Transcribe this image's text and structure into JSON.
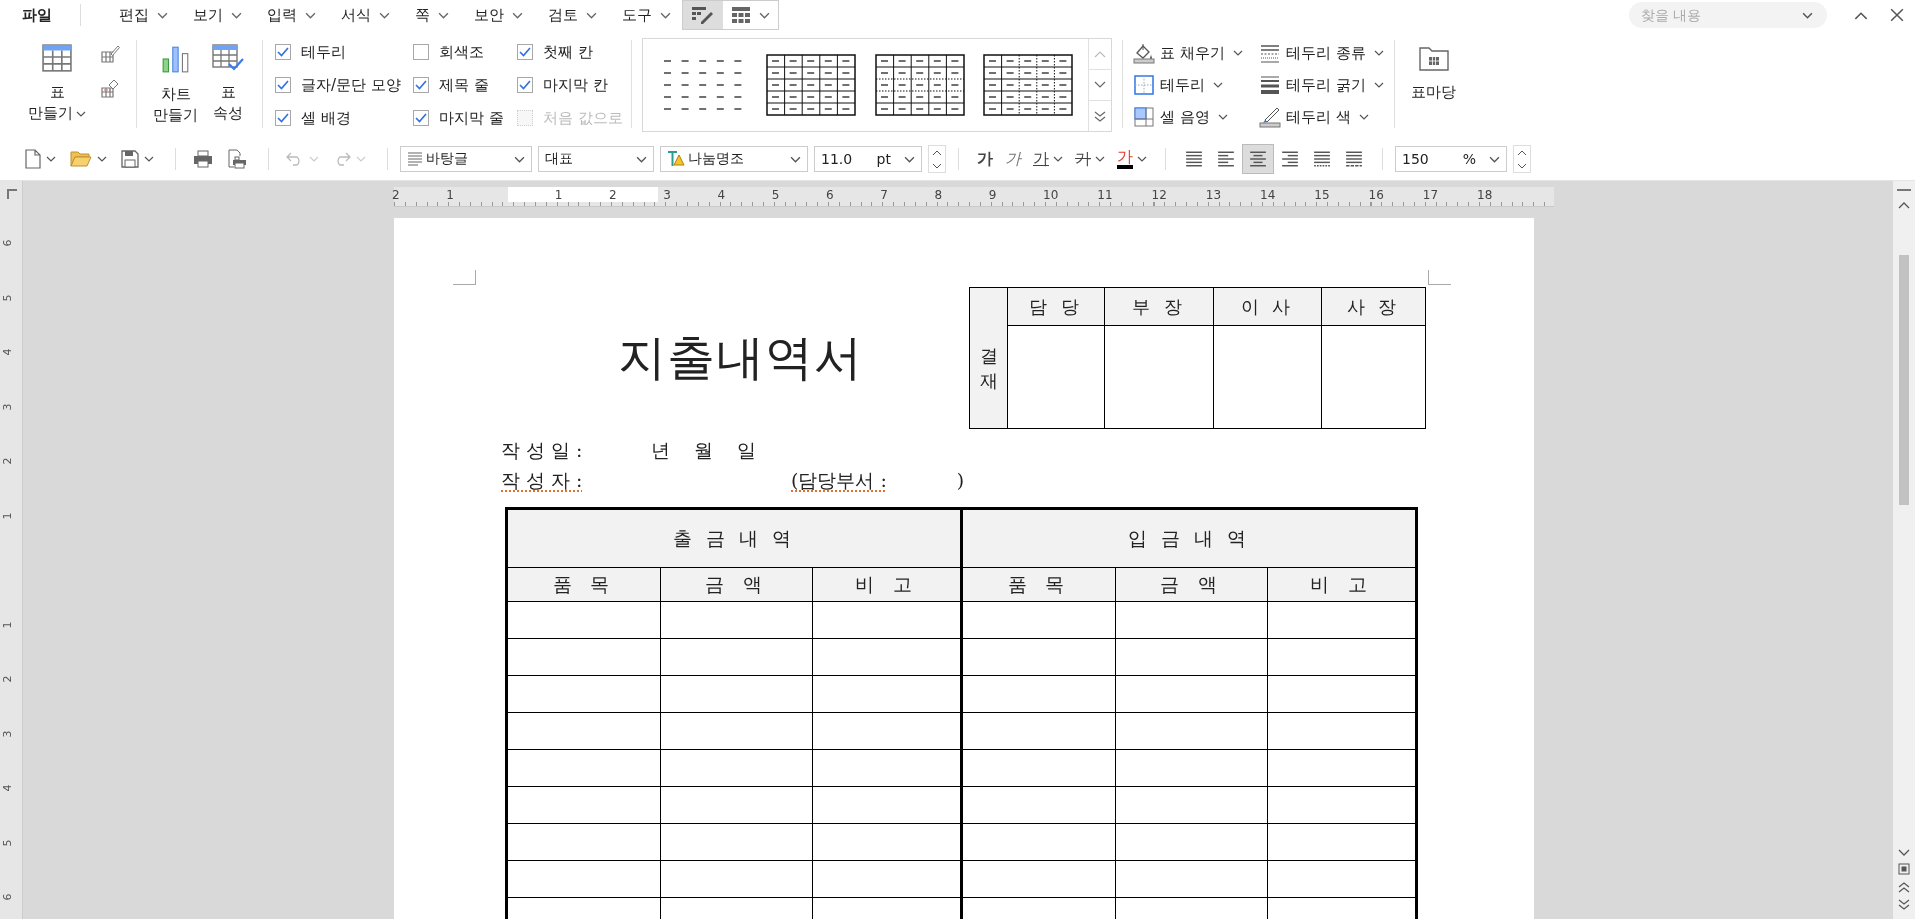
{
  "menu_bar": {
    "file_menu": "파일",
    "menus": [
      "편집",
      "보기",
      "입력",
      "서식",
      "쪽",
      "보안",
      "검토",
      "도구"
    ],
    "context_tabs": [
      {
        "kind": "table-design",
        "selected": true
      },
      {
        "kind": "table-layout",
        "selected": false
      }
    ]
  },
  "search": {
    "placeholder": "찾을 내용"
  },
  "ribbon": {
    "make_table": [
      "표",
      "만들기"
    ],
    "make_chart": [
      "차트",
      "만들기"
    ],
    "table_properties": [
      "표",
      "속성"
    ],
    "options": [
      {
        "label": "테두리",
        "checked": true,
        "disabled": false
      },
      {
        "label": "글자/문단 모양",
        "checked": true,
        "disabled": false
      },
      {
        "label": "셀 배경",
        "checked": true,
        "disabled": false
      },
      {
        "label": "회색조",
        "checked": false,
        "disabled": false
      },
      {
        "label": "제목 줄",
        "checked": true,
        "disabled": false
      },
      {
        "label": "마지막 줄",
        "checked": true,
        "disabled": false
      },
      {
        "label": "첫째 칸",
        "checked": true,
        "disabled": false
      },
      {
        "label": "마지막 칸",
        "checked": true,
        "disabled": false
      },
      {
        "label": "처음 값으로",
        "checked": false,
        "disabled": true
      }
    ],
    "tools": [
      {
        "kind": "fill",
        "label": "표 채우기"
      },
      {
        "kind": "border",
        "label": "테두리"
      },
      {
        "kind": "shade",
        "label": "셀 음영"
      },
      {
        "kind": "line-type",
        "label": "테두리 종류"
      },
      {
        "kind": "line-weight",
        "label": "테두리 굵기"
      },
      {
        "kind": "line-color",
        "label": "테두리 색"
      }
    ],
    "table_gallery": "표마당"
  },
  "toolbar": {
    "paragraph_style": "바탕글",
    "outline": "대표",
    "font": "나눔명조",
    "font_size": "11.0",
    "size_unit": "pt",
    "char_buttons": [
      {
        "kind": "bold",
        "label": "가"
      },
      {
        "kind": "italic",
        "label": "가"
      },
      {
        "kind": "underline",
        "label": "가"
      },
      {
        "kind": "strike",
        "label": "가"
      },
      {
        "kind": "color",
        "label": "가"
      }
    ],
    "alignments": [
      {
        "kind": "justify",
        "selected": false
      },
      {
        "kind": "left",
        "selected": false
      },
      {
        "kind": "center",
        "selected": true
      },
      {
        "kind": "right",
        "selected": false
      },
      {
        "kind": "distribute",
        "selected": false
      },
      {
        "kind": "divide",
        "selected": false
      }
    ],
    "zoom": "150",
    "zoom_unit": "%"
  },
  "ruler": {
    "horizontal": [
      "2",
      "1",
      "1",
      "2",
      "3",
      "4",
      "5",
      "6",
      "7",
      "8",
      "9",
      "10",
      "11",
      "12",
      "13",
      "14",
      "15",
      "16",
      "17",
      "18"
    ],
    "vertical": [
      "6",
      "5",
      "4",
      "3",
      "2",
      "1",
      "1",
      "2",
      "3",
      "4",
      "5",
      "6"
    ]
  },
  "document": {
    "title": "지출내역서",
    "approval": {
      "label": "결재",
      "roles": [
        "담 당",
        "부 장",
        "이 사",
        "사 장"
      ]
    },
    "date_label": "작 성 일 :",
    "date_value": "년    월    일",
    "author_label": "작 성 자 :",
    "department_label": "(담당부서 :",
    "department_close": ")",
    "ledger": {
      "groups": [
        "출 금 내 역",
        "입 금 내 역"
      ],
      "columns": [
        "품 목",
        "금 액",
        "비 고",
        "품 목",
        "금 액",
        "비 고"
      ]
    }
  }
}
